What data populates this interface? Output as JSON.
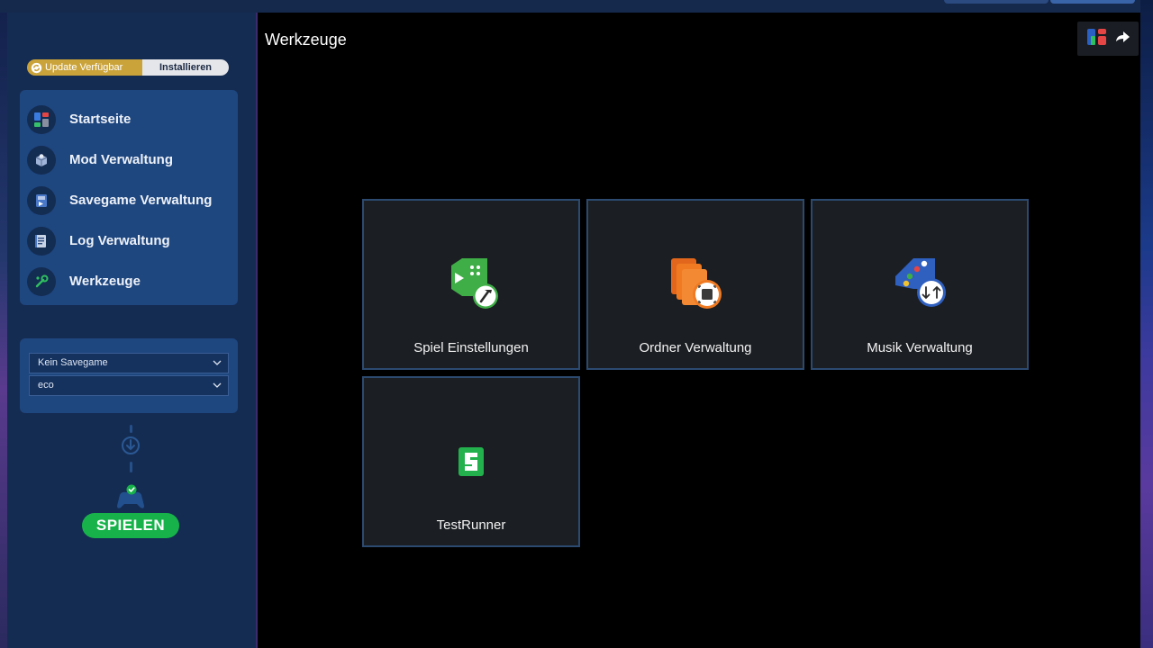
{
  "update": {
    "status_label": "Update Verfügbar",
    "install_label": "Installieren"
  },
  "sidebar": {
    "items": [
      {
        "label": "Startseite",
        "icon": "home-dashboard-icon"
      },
      {
        "label": "Mod Verwaltung",
        "icon": "mod-box-icon"
      },
      {
        "label": "Savegame Verwaltung",
        "icon": "savegame-icon"
      },
      {
        "label": "Log Verwaltung",
        "icon": "log-icon"
      },
      {
        "label": "Werkzeuge",
        "icon": "tools-icon"
      }
    ],
    "savegame_select": "Kein Savegame",
    "profile_select": "eco",
    "play_label": "SPIELEN"
  },
  "main": {
    "title": "Werkzeuge",
    "tools": [
      {
        "label": "Spiel Einstellungen",
        "icon": "game-settings-icon"
      },
      {
        "label": "Ordner Verwaltung",
        "icon": "folder-management-icon"
      },
      {
        "label": "Musik Verwaltung",
        "icon": "music-management-icon"
      },
      {
        "label": "TestRunner",
        "icon": "testrunner-icon"
      }
    ]
  },
  "colors": {
    "sidebar_bg": "#152c52",
    "card_bg": "#1e467f",
    "play_green": "#17b34a",
    "update_gold": "#caa33a",
    "tile_border": "#2c4a70"
  }
}
